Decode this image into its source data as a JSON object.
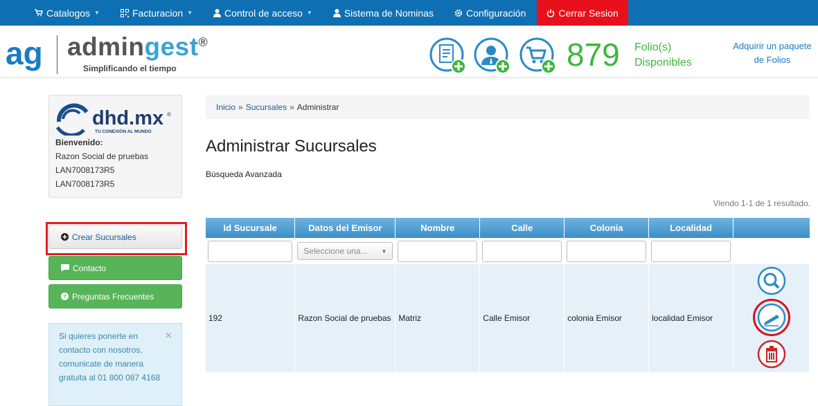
{
  "nav": {
    "catalogos": "Catalogos",
    "facturacion": "Facturacion",
    "control_acceso": "Control de acceso",
    "nominas": "Sistema de Nominas",
    "configuracion": "Configuración",
    "cerrar": "Cerrar Sesion"
  },
  "header": {
    "logo_short": "ag",
    "brand_a": "admin",
    "brand_b": "gest",
    "brand_reg": "®",
    "slogan": "Simplificando el tiempo",
    "folios_count": "879",
    "folios_line1": "Folio(s)",
    "folios_line2": "Disponibles",
    "buy_line1": "Adquirir un paquete",
    "buy_line2": "de Folios"
  },
  "profile": {
    "logo_text": "dhd.mx",
    "logo_reg": "®",
    "logo_tagline": "TU CONEXIÓN AL MUNDO",
    "welcome": "Bienvenido:",
    "razon": "Razon Social de pruebas",
    "rfc1": "LAN7008173R5",
    "rfc2": "LAN7008173R5"
  },
  "sidebar": {
    "crear": "Crear Sucursales",
    "contacto": "Contacto",
    "preguntas": "Preguntas Frecuentes",
    "info": "Si quieres ponerte en contacto con nosotros, comunicate de manera gratuita al 01 800 087 4168",
    "info_close": "×"
  },
  "breadcrumb": {
    "inicio": "Inicio",
    "sucursales": "Sucursales",
    "sep": "»",
    "current": "Administrar"
  },
  "page": {
    "title": "Administrar Sucursales",
    "advanced_search": "Búsqueda Avanzada",
    "summary": "Viendo 1-1 de 1 resultado."
  },
  "table": {
    "headers": [
      "Id Sucursale",
      "Datos del Emisor",
      "Nombre",
      "Calle",
      "Colonia",
      "Localidad",
      ""
    ],
    "select_placeholder": "Seleccione una...",
    "rows": [
      [
        "192",
        "Razon Social de pruebas",
        "Matriz",
        "Calle Emisor",
        "colonia Emisor",
        "localidad Emisor"
      ]
    ]
  },
  "colors": {
    "nav_bg": "#0f6fb3",
    "logout_bg": "#e8101a",
    "folios_green": "#3cb83c",
    "highlight_red": "#e31c23",
    "table_header": "#3b8ec9"
  }
}
